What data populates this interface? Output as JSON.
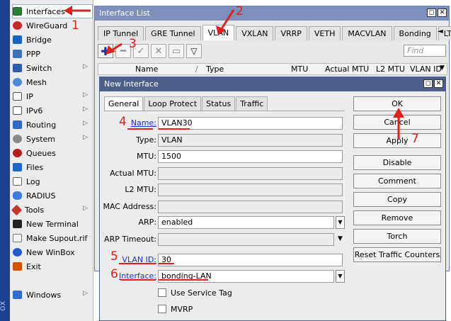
{
  "sidebar": {
    "brand_strip": "OX",
    "items": [
      {
        "label": "Interfaces",
        "icon": "interfaces-icon"
      },
      {
        "label": "WireGuard",
        "icon": "wireguard-icon"
      },
      {
        "label": "Bridge",
        "icon": "bridge-icon"
      },
      {
        "label": "PPP",
        "icon": "ppp-icon"
      },
      {
        "label": "Switch",
        "icon": "switch-icon",
        "submenu": true
      },
      {
        "label": "Mesh",
        "icon": "mesh-icon"
      },
      {
        "label": "IP",
        "icon": "ip-icon",
        "submenu": true
      },
      {
        "label": "IPv6",
        "icon": "ipv6-icon",
        "submenu": true
      },
      {
        "label": "Routing",
        "icon": "routing-icon",
        "submenu": true
      },
      {
        "label": "System",
        "icon": "system-icon",
        "submenu": true
      },
      {
        "label": "Queues",
        "icon": "queues-icon"
      },
      {
        "label": "Files",
        "icon": "files-icon"
      },
      {
        "label": "Log",
        "icon": "log-icon"
      },
      {
        "label": "RADIUS",
        "icon": "radius-icon"
      },
      {
        "label": "Tools",
        "icon": "tools-icon",
        "submenu": true
      },
      {
        "label": "New Terminal",
        "icon": "terminal-icon"
      },
      {
        "label": "Make Supout.rif",
        "icon": "supout-icon"
      },
      {
        "label": "New WinBox",
        "icon": "winbox-icon"
      },
      {
        "label": "Exit",
        "icon": "exit-icon"
      },
      {
        "label": "Windows",
        "icon": "windows-icon",
        "submenu": true
      }
    ],
    "submenu_glyph": "▷"
  },
  "interface_list": {
    "title": "Interface List",
    "tabs": [
      "IP Tunnel",
      "GRE Tunnel",
      "VLAN",
      "VXLAN",
      "VRRP",
      "VETH",
      "MACVLAN",
      "Bonding",
      "LTE"
    ],
    "active_tab": "VLAN",
    "tab_scroll": "◄",
    "find_placeholder": "Find",
    "columns": [
      "Name",
      "Type",
      "MTU",
      "Actual MTU",
      "L2 MTU",
      "VLAN ID"
    ],
    "column_dropdown": "▼",
    "sort_glyph": "/"
  },
  "dialog": {
    "title": "New Interface",
    "tabs": [
      "General",
      "Loop Protect",
      "Status",
      "Traffic"
    ],
    "active_tab": "General",
    "fields": {
      "name": {
        "label": "Name:",
        "value": "VLAN30"
      },
      "type": {
        "label": "Type:",
        "value": "VLAN"
      },
      "mtu": {
        "label": "MTU:",
        "value": "1500"
      },
      "actual_mtu": {
        "label": "Actual MTU:",
        "value": ""
      },
      "l2_mtu": {
        "label": "L2 MTU:",
        "value": ""
      },
      "mac_address": {
        "label": "MAC Address:",
        "value": ""
      },
      "arp": {
        "label": "ARP:",
        "value": "enabled"
      },
      "arp_timeout": {
        "label": "ARP Timeout:",
        "value": ""
      },
      "vlan_id": {
        "label": "VLAN ID:",
        "value": "30"
      },
      "interface": {
        "label": "Interface:",
        "value": "bonding-LAN"
      }
    },
    "checkboxes": [
      {
        "label": "Use Service Tag",
        "checked": false
      },
      {
        "label": "MVRP",
        "checked": false
      }
    ],
    "buttons": [
      "OK",
      "Cancel",
      "Apply",
      "Disable",
      "Comment",
      "Copy",
      "Remove",
      "Torch",
      "Reset Traffic Counters"
    ],
    "dropdown_glyph": "▼"
  },
  "window_controls": {
    "restore": "◻",
    "close": "✕"
  },
  "annotations": [
    "1",
    "2",
    "3",
    "4",
    "5",
    "6",
    "7"
  ],
  "colors": {
    "annotation": "#e0201c",
    "window_title": "#7d8fb8",
    "dialog_title": "#4e5f8c",
    "link_label": "#1a2fd4"
  }
}
